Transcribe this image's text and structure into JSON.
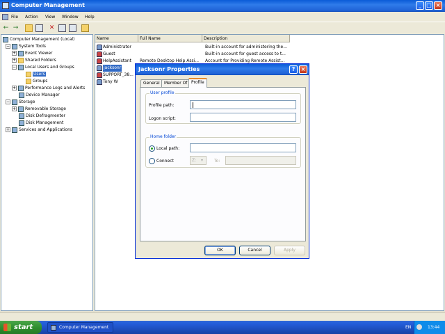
{
  "window": {
    "title": "Computer Management"
  },
  "menu": [
    "File",
    "Action",
    "View",
    "Window",
    "Help"
  ],
  "tree": {
    "root": "Computer Management (Local)",
    "system_tools": "System Tools",
    "event_viewer": "Event Viewer",
    "shared_folders": "Shared Folders",
    "local_users_groups": "Local Users and Groups",
    "users": "Users",
    "groups": "Groups",
    "perf_logs": "Performance Logs and Alerts",
    "device_manager": "Device Manager",
    "storage": "Storage",
    "removable_storage": "Removable Storage",
    "disk_defrag": "Disk Defragmenter",
    "disk_mgmt": "Disk Management",
    "services_apps": "Services and Applications"
  },
  "list": {
    "columns": [
      "Name",
      "Full Name",
      "Description"
    ],
    "rows": [
      {
        "name": "Administrator",
        "full": "",
        "desc": "Built-in account for administering the..."
      },
      {
        "name": "Guest",
        "full": "",
        "desc": "Built-in account for guest access to t..."
      },
      {
        "name": "HelpAssistant",
        "full": "Remote Desktop Help Assi...",
        "desc": "Account for Providing Remote Assist..."
      },
      {
        "name": "jacksonr",
        "full": "",
        "desc": ""
      },
      {
        "name": "SUPPORT_38...",
        "full": "",
        "desc": ""
      },
      {
        "name": "Tony W",
        "full": "",
        "desc": ""
      }
    ]
  },
  "dialog": {
    "title": "Jacksonr Properties",
    "tabs": [
      "General",
      "Member Of",
      "Profile"
    ],
    "active_tab": "Profile",
    "user_profile": {
      "group_label": "User profile",
      "profile_path_label": "Profile path:",
      "profile_path_value": "",
      "logon_script_label": "Logon script:",
      "logon_script_value": ""
    },
    "home_folder": {
      "group_label": "Home folder",
      "local_path_label": "Local path:",
      "local_path_value": "",
      "connect_label": "Connect",
      "drive_value": "Z:",
      "to_label": "To:",
      "to_value": "",
      "selected_option": "Local path"
    },
    "buttons": {
      "ok": "OK",
      "cancel": "Cancel",
      "apply": "Apply"
    }
  },
  "taskbar": {
    "start_label": "start",
    "task_label": "Computer Management",
    "language": "EN",
    "clock": "13:44"
  },
  "colors": {
    "titlebar": "#0a5bd8",
    "selection": "#316ac5",
    "taskbar": "#245edb",
    "start": "#2f8f2f"
  }
}
